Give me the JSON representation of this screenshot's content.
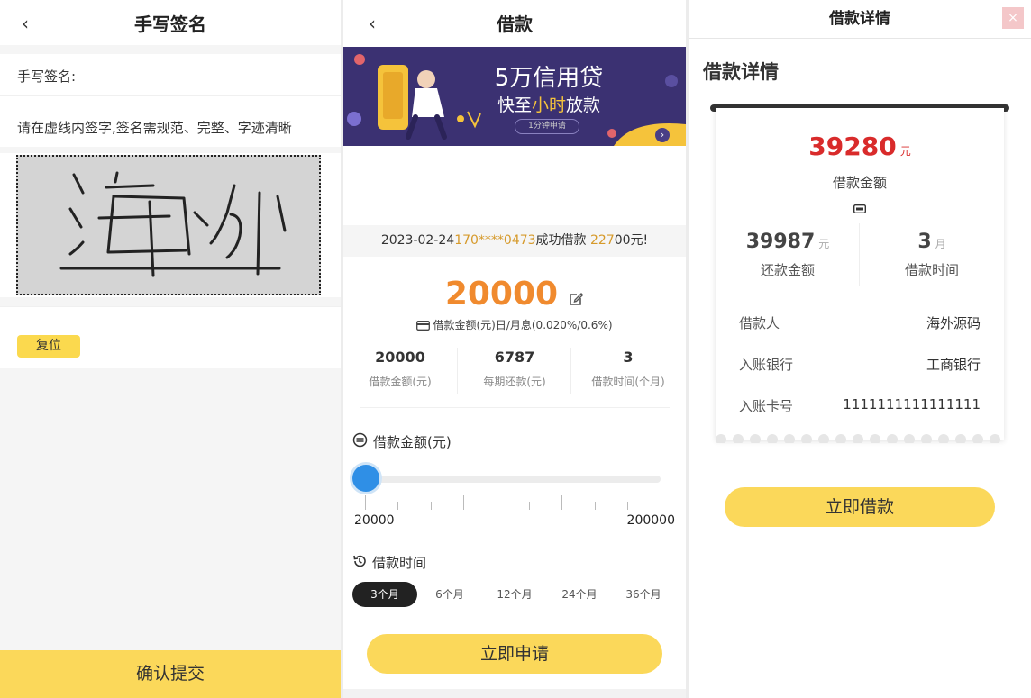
{
  "signature_page": {
    "title": "手写签名",
    "label": "手写签名:",
    "hint": "请在虚线内签字,签名需规范、完整、字迹清晰",
    "signature_text": "海外",
    "reset_label": "复位",
    "submit_label": "确认提交"
  },
  "loan_page": {
    "title": "借款",
    "banner": {
      "headline": "5万信用贷",
      "sub_prefix": "快至",
      "sub_highlight": "小时",
      "sub_suffix": "放款",
      "pill": "1分钟申请"
    },
    "ticker": {
      "date": "2023-02-24",
      "phone": "170****0473",
      "mid": "成功借款",
      "amount": "227",
      "suffix": "00元!"
    },
    "amount": "20000",
    "amount_desc": "借款金额(元)日/月息(0.020%/0.6%)",
    "stats": [
      {
        "value": "20000",
        "label": "借款金额(元)"
      },
      {
        "value": "6787",
        "label": "每期还款(元)"
      },
      {
        "value": "3",
        "label": "借款时间(个月)"
      }
    ],
    "amount_section_title": "借款金额(元)",
    "slider": {
      "min": "20000",
      "max": "200000",
      "value_fraction": 0.0
    },
    "term_section_title": "借款时间",
    "terms": [
      "3个月",
      "6个月",
      "12个月",
      "24个月",
      "36个月"
    ],
    "selected_term_index": 0,
    "apply_label": "立即申请"
  },
  "detail_page": {
    "window_title": "借款详情",
    "close_label": "×",
    "heading": "借款详情",
    "amount": "39280",
    "amount_unit": "元",
    "amount_label": "借款金额",
    "repay_amount": "39987",
    "repay_unit": "元",
    "repay_label": "还款金额",
    "term": "3",
    "term_unit": "月",
    "term_label": "借款时间",
    "rows": [
      {
        "key": "借款人",
        "value": "海外源码"
      },
      {
        "key": "入账银行",
        "value": "工商银行"
      },
      {
        "key": "入账卡号",
        "value": "1111111111111111"
      }
    ],
    "borrow_label": "立即借款"
  },
  "colors": {
    "accent_yellow": "#fbd85a",
    "amount_orange": "#f08a2e",
    "amount_red": "#d92b2b",
    "slider_blue": "#2f8fe6",
    "banner_purple": "#3b3172"
  }
}
